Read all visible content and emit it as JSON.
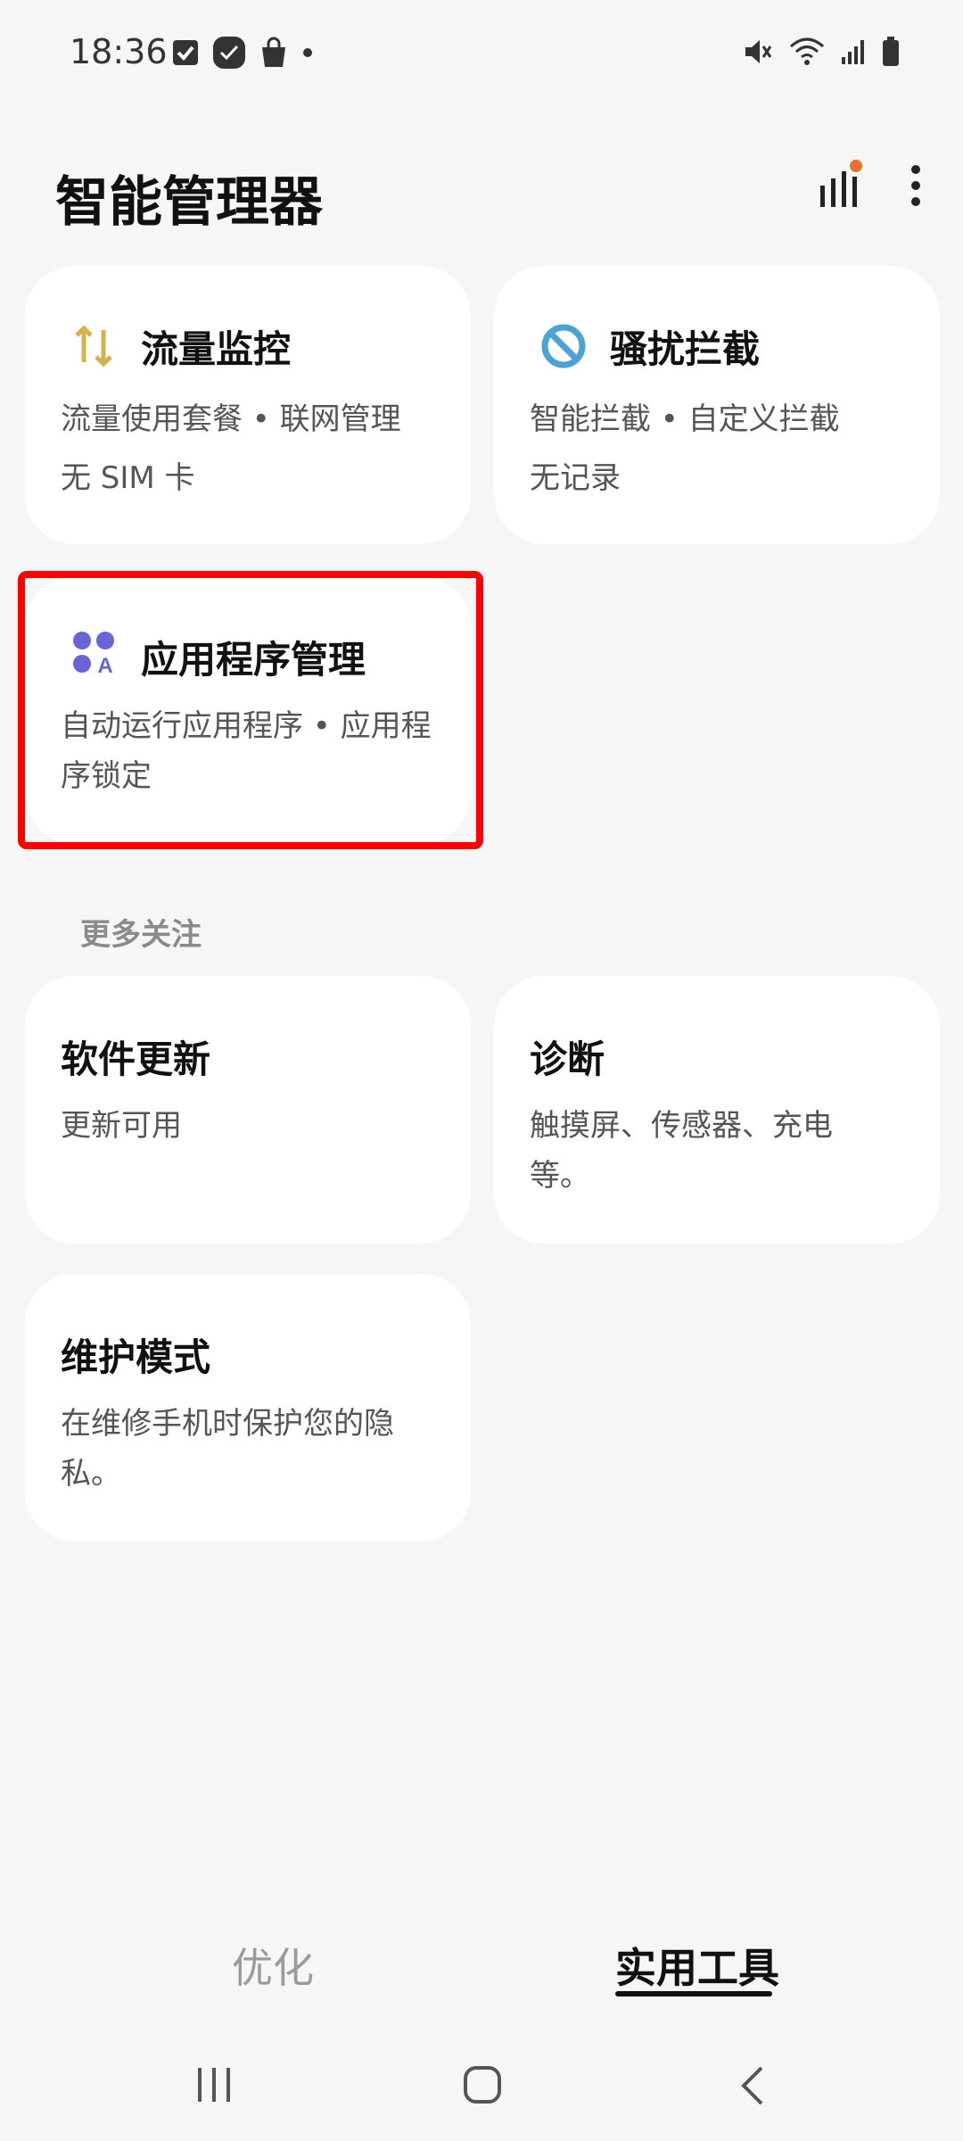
{
  "status_bar": {
    "time": "18:36"
  },
  "header": {
    "title": "智能管理器"
  },
  "cards": {
    "data_monitor": {
      "title": "流量监控",
      "desc": "流量使用套餐 • 联网管理",
      "status": "无 SIM 卡"
    },
    "block": {
      "title": "骚扰拦截",
      "desc": "智能拦截 • 自定义拦截",
      "status": "无记录"
    },
    "app_management": {
      "title": "应用程序管理",
      "desc": "自动运行应用程序 • 应用程序锁定"
    }
  },
  "more": {
    "header": "更多关注",
    "software_update": {
      "title": "软件更新",
      "desc": "更新可用"
    },
    "diagnostics": {
      "title": "诊断",
      "desc": "触摸屏、传感器、充电等。"
    },
    "maintenance": {
      "title": "维护模式",
      "desc": "在维修手机时保护您的隐私。"
    }
  },
  "tabs": {
    "optimize": "优化",
    "tools": "实用工具"
  },
  "colors": {
    "data_icon": "#d6b24a",
    "block_icon": "#4aa3d4",
    "app_icon": "#6b64d6",
    "badge": "#e8702a",
    "highlight": "#ff0000"
  }
}
